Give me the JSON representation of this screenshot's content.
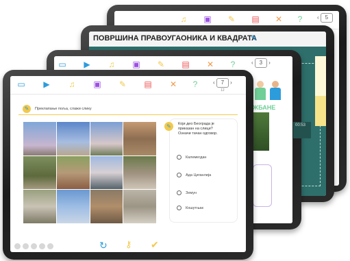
{
  "toolbar": {
    "icons": [
      "book-icon",
      "video-icon",
      "music-icon",
      "cube-icon",
      "eraser-icon",
      "image-icon",
      "cross-icon",
      "help-icon"
    ],
    "pager_back": {
      "page": "5"
    },
    "pager_mid": {
      "page": "3"
    },
    "pager_front": {
      "page": "7",
      "total": "12"
    }
  },
  "back_slide": {
    "title": "ПОВРШИНА ПРАВОУГАОНИКА И КВАДРАТА",
    "video_time": "00:53"
  },
  "mid_slide": {
    "banner_text": "ЖБАНЕ"
  },
  "front_slide": {
    "instruction": "Преклапање поља, слажи слику",
    "question": "Који део Београда је приказан на слици? Означи тачан одговор.",
    "options": [
      "Калемегдан",
      "Ада Циганлија",
      "Земун",
      "Кошутњак"
    ]
  },
  "colors": {
    "accent_yellow": "#f2c94c",
    "teal": "#2e6f6b",
    "pencil": "#2d9cdb",
    "bezel": "#222222"
  }
}
